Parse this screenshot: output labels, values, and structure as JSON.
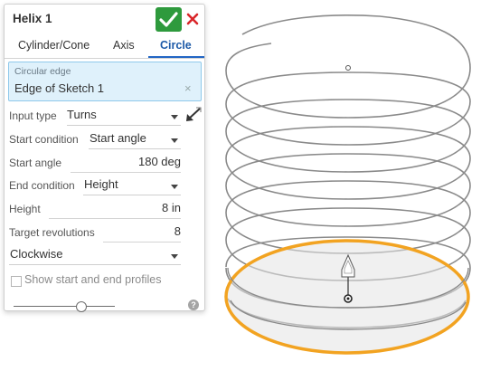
{
  "panel": {
    "title": "Helix 1",
    "tabs": [
      {
        "label": "Cylinder/Cone",
        "active": false
      },
      {
        "label": "Axis",
        "active": false
      },
      {
        "label": "Circle",
        "active": true
      }
    ],
    "circular_edge": {
      "label": "Circular edge",
      "value": "Edge of Sketch 1"
    },
    "input_type": {
      "label": "Input type",
      "value": "Turns"
    },
    "start_condition": {
      "label": "Start condition",
      "value": "Start angle"
    },
    "start_angle": {
      "label": "Start angle",
      "value": "180 deg"
    },
    "end_condition": {
      "label": "End condition",
      "value": "Height"
    },
    "height": {
      "label": "Height",
      "value": "8 in"
    },
    "target_revolutions": {
      "label": "Target revolutions",
      "value": "8"
    },
    "direction": {
      "value": "Clockwise"
    },
    "show_profiles": {
      "label": "Show start and end profiles",
      "checked": false
    },
    "help": "?"
  },
  "colors": {
    "ok": "#2e9a3d",
    "cancel": "#d9262a",
    "accent": "#2266c4",
    "selection_fill": "#dff1fb",
    "highlight_edge": "#f2a321",
    "helix_stroke": "#8a8a8a"
  },
  "icons": [
    "checkmark-icon",
    "close-icon",
    "clear-icon",
    "flip-direction-icon",
    "chevron-down-icon",
    "help-icon",
    "manipulator-arrow-icon"
  ],
  "viewport": {
    "helix_turns": 8
  }
}
